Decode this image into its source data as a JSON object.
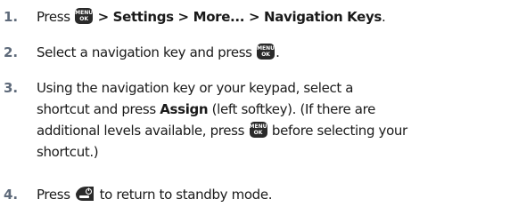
{
  "keys": {
    "menu_ok": {
      "line1": "MENU",
      "line2": "OK",
      "icon": "menu-ok-key-icon"
    },
    "end": {
      "icon": "end-power-key-icon"
    }
  },
  "steps": [
    {
      "number": "1.",
      "text_before": "Press ",
      "bold_path": "> Settings > More... > Navigation Keys",
      "text_after": "."
    },
    {
      "number": "2.",
      "text_before": "Select a navigation key and press ",
      "text_after": "."
    },
    {
      "number": "3.",
      "line1": "Using the navigation key or your keypad, select a",
      "line2_before": "shortcut and press ",
      "line2_bold": "Assign",
      "line2_after": " (left softkey). (If there are",
      "line3_before": "additional levels available, press ",
      "line3_after": " before selecting your",
      "line4": "shortcut.)"
    },
    {
      "number": "4.",
      "text_before": "Press ",
      "text_after": " to return to standby mode."
    }
  ]
}
